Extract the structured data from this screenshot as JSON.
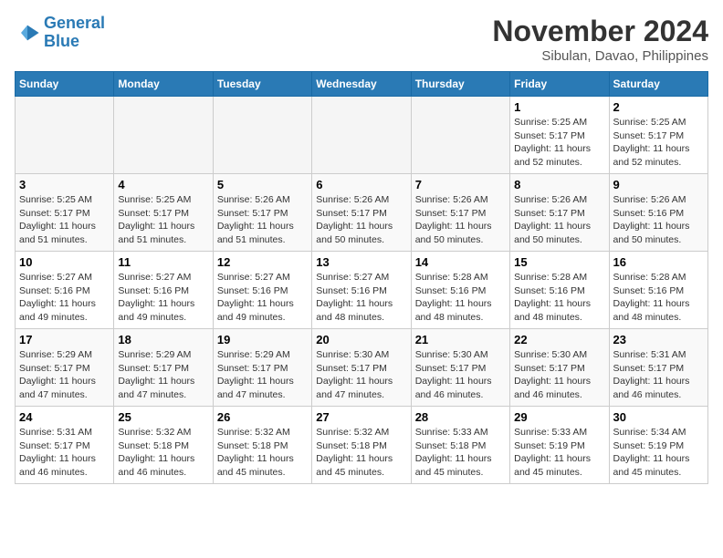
{
  "logo": {
    "line1": "General",
    "line2": "Blue"
  },
  "title": "November 2024",
  "location": "Sibulan, Davao, Philippines",
  "weekdays": [
    "Sunday",
    "Monday",
    "Tuesday",
    "Wednesday",
    "Thursday",
    "Friday",
    "Saturday"
  ],
  "weeks": [
    [
      {
        "day": "",
        "info": ""
      },
      {
        "day": "",
        "info": ""
      },
      {
        "day": "",
        "info": ""
      },
      {
        "day": "",
        "info": ""
      },
      {
        "day": "",
        "info": ""
      },
      {
        "day": "1",
        "info": "Sunrise: 5:25 AM\nSunset: 5:17 PM\nDaylight: 11 hours\nand 52 minutes."
      },
      {
        "day": "2",
        "info": "Sunrise: 5:25 AM\nSunset: 5:17 PM\nDaylight: 11 hours\nand 52 minutes."
      }
    ],
    [
      {
        "day": "3",
        "info": "Sunrise: 5:25 AM\nSunset: 5:17 PM\nDaylight: 11 hours\nand 51 minutes."
      },
      {
        "day": "4",
        "info": "Sunrise: 5:25 AM\nSunset: 5:17 PM\nDaylight: 11 hours\nand 51 minutes."
      },
      {
        "day": "5",
        "info": "Sunrise: 5:26 AM\nSunset: 5:17 PM\nDaylight: 11 hours\nand 51 minutes."
      },
      {
        "day": "6",
        "info": "Sunrise: 5:26 AM\nSunset: 5:17 PM\nDaylight: 11 hours\nand 50 minutes."
      },
      {
        "day": "7",
        "info": "Sunrise: 5:26 AM\nSunset: 5:17 PM\nDaylight: 11 hours\nand 50 minutes."
      },
      {
        "day": "8",
        "info": "Sunrise: 5:26 AM\nSunset: 5:17 PM\nDaylight: 11 hours\nand 50 minutes."
      },
      {
        "day": "9",
        "info": "Sunrise: 5:26 AM\nSunset: 5:16 PM\nDaylight: 11 hours\nand 50 minutes."
      }
    ],
    [
      {
        "day": "10",
        "info": "Sunrise: 5:27 AM\nSunset: 5:16 PM\nDaylight: 11 hours\nand 49 minutes."
      },
      {
        "day": "11",
        "info": "Sunrise: 5:27 AM\nSunset: 5:16 PM\nDaylight: 11 hours\nand 49 minutes."
      },
      {
        "day": "12",
        "info": "Sunrise: 5:27 AM\nSunset: 5:16 PM\nDaylight: 11 hours\nand 49 minutes."
      },
      {
        "day": "13",
        "info": "Sunrise: 5:27 AM\nSunset: 5:16 PM\nDaylight: 11 hours\nand 48 minutes."
      },
      {
        "day": "14",
        "info": "Sunrise: 5:28 AM\nSunset: 5:16 PM\nDaylight: 11 hours\nand 48 minutes."
      },
      {
        "day": "15",
        "info": "Sunrise: 5:28 AM\nSunset: 5:16 PM\nDaylight: 11 hours\nand 48 minutes."
      },
      {
        "day": "16",
        "info": "Sunrise: 5:28 AM\nSunset: 5:16 PM\nDaylight: 11 hours\nand 48 minutes."
      }
    ],
    [
      {
        "day": "17",
        "info": "Sunrise: 5:29 AM\nSunset: 5:17 PM\nDaylight: 11 hours\nand 47 minutes."
      },
      {
        "day": "18",
        "info": "Sunrise: 5:29 AM\nSunset: 5:17 PM\nDaylight: 11 hours\nand 47 minutes."
      },
      {
        "day": "19",
        "info": "Sunrise: 5:29 AM\nSunset: 5:17 PM\nDaylight: 11 hours\nand 47 minutes."
      },
      {
        "day": "20",
        "info": "Sunrise: 5:30 AM\nSunset: 5:17 PM\nDaylight: 11 hours\nand 47 minutes."
      },
      {
        "day": "21",
        "info": "Sunrise: 5:30 AM\nSunset: 5:17 PM\nDaylight: 11 hours\nand 46 minutes."
      },
      {
        "day": "22",
        "info": "Sunrise: 5:30 AM\nSunset: 5:17 PM\nDaylight: 11 hours\nand 46 minutes."
      },
      {
        "day": "23",
        "info": "Sunrise: 5:31 AM\nSunset: 5:17 PM\nDaylight: 11 hours\nand 46 minutes."
      }
    ],
    [
      {
        "day": "24",
        "info": "Sunrise: 5:31 AM\nSunset: 5:17 PM\nDaylight: 11 hours\nand 46 minutes."
      },
      {
        "day": "25",
        "info": "Sunrise: 5:32 AM\nSunset: 5:18 PM\nDaylight: 11 hours\nand 46 minutes."
      },
      {
        "day": "26",
        "info": "Sunrise: 5:32 AM\nSunset: 5:18 PM\nDaylight: 11 hours\nand 45 minutes."
      },
      {
        "day": "27",
        "info": "Sunrise: 5:32 AM\nSunset: 5:18 PM\nDaylight: 11 hours\nand 45 minutes."
      },
      {
        "day": "28",
        "info": "Sunrise: 5:33 AM\nSunset: 5:18 PM\nDaylight: 11 hours\nand 45 minutes."
      },
      {
        "day": "29",
        "info": "Sunrise: 5:33 AM\nSunset: 5:19 PM\nDaylight: 11 hours\nand 45 minutes."
      },
      {
        "day": "30",
        "info": "Sunrise: 5:34 AM\nSunset: 5:19 PM\nDaylight: 11 hours\nand 45 minutes."
      }
    ]
  ]
}
